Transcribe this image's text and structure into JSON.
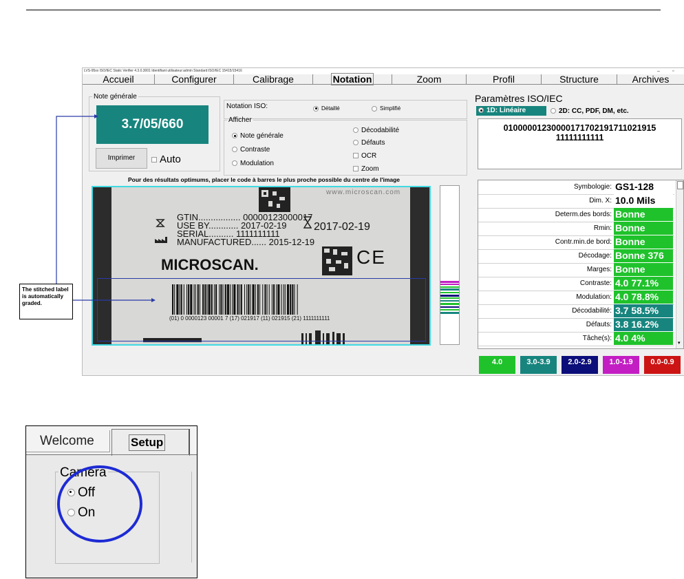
{
  "window": {
    "title_bar": "LVS-95xx ISO/IEC Static Verifier 4.3.0.3001   Identifiant utilisateur:admin   Standard:ISO/IEC 15415/15416",
    "minimize": "–",
    "maximize": "▫"
  },
  "tabs": [
    "Accueil",
    "Configurer",
    "Calibrage",
    "Notation",
    "Zoom",
    "Profil",
    "Structure",
    "Archives"
  ],
  "overall": {
    "legend": "Note générale",
    "grade": "3.7/05/660",
    "print_button": "Imprimer",
    "auto_label": "Auto"
  },
  "iso_notation": {
    "label": "Notation ISO:",
    "options": [
      "Détaillé",
      "Simplifié"
    ]
  },
  "display": {
    "legend": "Afficher",
    "left_options": [
      "Note générale",
      "Contraste",
      "Modulation"
    ],
    "right_options": [
      "Décodabilité",
      "Défauts",
      "OCR",
      "Zoom"
    ]
  },
  "hint": "Pour des résultats optimums, placer le code à barres le plus proche possible du centre de l'image",
  "label_image": {
    "url_text": "www.microscan.com",
    "gtin_key": "GTIN.................",
    "gtin_val": "00000123000017",
    "use_by_key": "USE BY............",
    "use_by_val": "2017-02-19",
    "serial_key": "SERIAL..........",
    "serial_val": "1111111111",
    "manufactured_key": "MANUFACTURED......",
    "manufactured_val": "2015-12-19",
    "expiry_big": "2017-02-19",
    "ce_mark": "CE",
    "brand": "MICROSCAN.",
    "hri": "(01) 0 0000123 00001 7 (17) 021917 (11) 021915 (21) 1111111111"
  },
  "params": {
    "title": "Paramètres ISO/IEC",
    "mode_1d": "1D: Linéaire",
    "mode_2d": "2D: CC, PDF, DM, etc.",
    "decoded_line1": "01000001230000171702191711021915",
    "decoded_line2": "11111111111",
    "rows": [
      {
        "key": "Symbologie:",
        "value": "GS1-128",
        "color": "#ffffff"
      },
      {
        "key": "Dim. X:",
        "value": "10.0 Mils",
        "color": "#ffffff"
      },
      {
        "key": "Determ.des bords:",
        "value": "Bonne",
        "color": "#1fc22b"
      },
      {
        "key": "Rmin:",
        "value": "Bonne",
        "color": "#1fc22b"
      },
      {
        "key": "Contr.min.de bord:",
        "value": "Bonne",
        "color": "#1fc22b"
      },
      {
        "key": "Décodage:",
        "value": "Bonne 376",
        "color": "#1fc22b"
      },
      {
        "key": "Marges:",
        "value": "Bonne",
        "color": "#1fc22b"
      },
      {
        "key": "Contraste:",
        "value": "4.0  77.1%",
        "color": "#1fc22b"
      },
      {
        "key": "Modulation:",
        "value": "4.0  78.8%",
        "color": "#1fc22b"
      },
      {
        "key": "Décodabilité:",
        "value": "3.7  58.5%",
        "color": "#17857e"
      },
      {
        "key": "Défauts:",
        "value": "3.8  16.2%",
        "color": "#17857e"
      },
      {
        "key": "Tâche(s):",
        "value": "4.0  4%",
        "color": "#1fc22b"
      }
    ]
  },
  "grade_legend": [
    {
      "label": "4.0",
      "color": "#1fc22b"
    },
    {
      "label": "3.0-3.9",
      "color": "#17857e"
    },
    {
      "label": "2.0-2.9",
      "color": "#0c0e7a"
    },
    {
      "label": "1.0-1.9",
      "color": "#c31ec4"
    },
    {
      "label": "0.0-0.9",
      "color": "#cc1414"
    }
  ],
  "callout": "The stitched label is automatically graded.",
  "inset": {
    "tab_welcome": "Welcome",
    "tab_setup": "Setup",
    "group": "Camera",
    "options": [
      "Off",
      "On"
    ]
  }
}
